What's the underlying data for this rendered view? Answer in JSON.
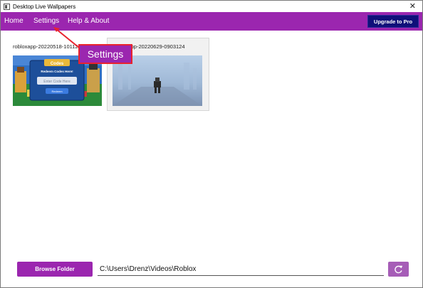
{
  "window": {
    "title": "Desktop Live Wallpapers",
    "close_glyph": "✕"
  },
  "menu": {
    "home": "Home",
    "settings": "Settings",
    "help": "Help & About",
    "upgrade": "Upgrade to Pro"
  },
  "wallpapers": [
    {
      "title": "robloxapp-20220518-10112",
      "overlay_header": "Codes",
      "overlay_subheader": "Redeem Codes Here!",
      "overlay_input_placeholder": "Enter Code Here",
      "overlay_button": "Redeem"
    },
    {
      "title": "robloxapp-20220629-0903124"
    }
  ],
  "annotation": {
    "label": "Settings"
  },
  "bottom": {
    "browse_label": "Browse Folder",
    "folder_path": "C:\\Users\\Drenz\\Videos\\Roblox"
  },
  "colors": {
    "accent": "#9b26af",
    "upgrade_bg": "#10107a",
    "annotation_border": "#e8232e"
  },
  "icons": {
    "app": "app-icon",
    "close": "close-icon",
    "refresh": "refresh-icon"
  }
}
